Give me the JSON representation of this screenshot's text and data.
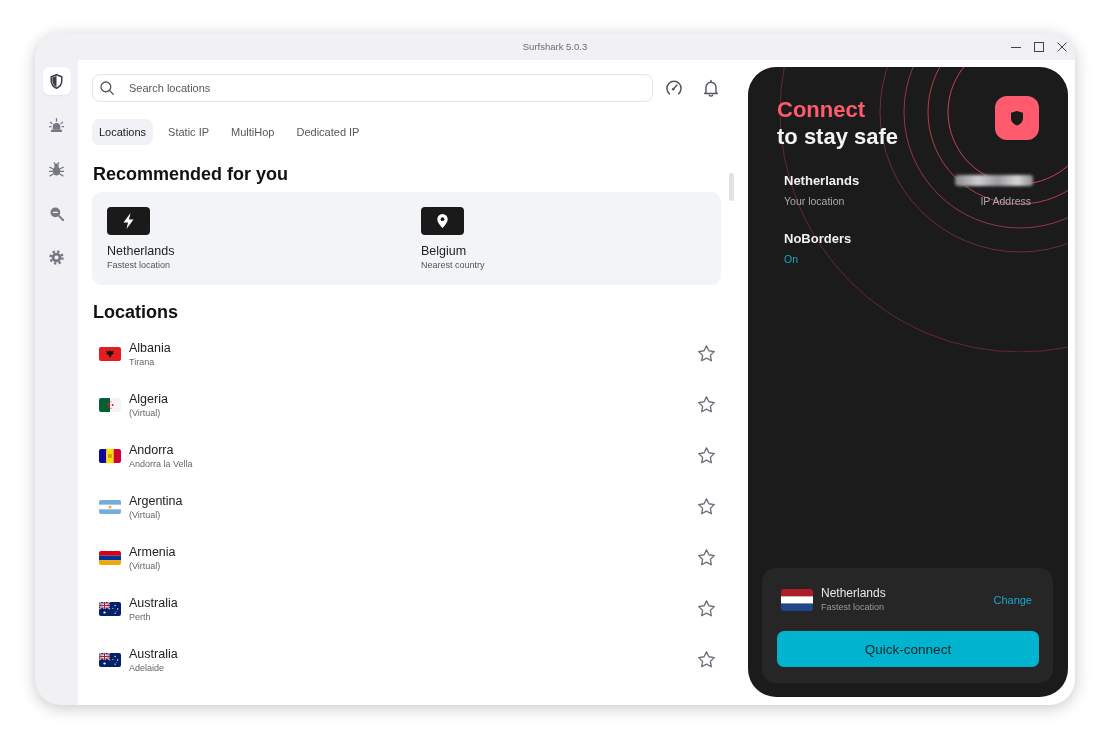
{
  "window": {
    "title": "Surfshark 5.0.3"
  },
  "sidebar": {
    "items": [
      {
        "kind": "shield",
        "selected": true
      },
      {
        "kind": "alert",
        "selected": false
      },
      {
        "kind": "bug",
        "selected": false
      },
      {
        "kind": "search",
        "selected": false
      },
      {
        "kind": "settings",
        "selected": false
      }
    ]
  },
  "search": {
    "placeholder": "Search locations"
  },
  "tabs": [
    {
      "label": "Locations",
      "selected": true
    },
    {
      "label": "Static IP",
      "selected": false
    },
    {
      "label": "MultiHop",
      "selected": false
    },
    {
      "label": "Dedicated IP",
      "selected": false
    }
  ],
  "recommended": {
    "title": "Recommended for you",
    "items": [
      {
        "kind": "fastest",
        "name": "Netherlands",
        "detail": "Fastest location"
      },
      {
        "kind": "nearest",
        "name": "Belgium",
        "detail": "Nearest country"
      }
    ]
  },
  "locations": {
    "title": "Locations",
    "rows": [
      {
        "flag": {
          "kind": "albania"
        },
        "name": "Albania",
        "detail": "Tirana",
        "favorite": false
      },
      {
        "flag": {
          "kind": "algeria"
        },
        "name": "Algeria",
        "detail": "(Virtual)",
        "favorite": false
      },
      {
        "flag": {
          "kind": "andorra"
        },
        "name": "Andorra",
        "detail": "Andorra la Vella",
        "favorite": false
      },
      {
        "flag": {
          "kind": "argentina"
        },
        "name": "Argentina",
        "detail": "(Virtual)",
        "favorite": false
      },
      {
        "flag": {
          "kind": "armenia"
        },
        "name": "Armenia",
        "detail": "(Virtual)",
        "favorite": false
      },
      {
        "flag": {
          "kind": "australia"
        },
        "name": "Australia",
        "detail": "Perth",
        "favorite": false
      },
      {
        "flag": {
          "kind": "australia"
        },
        "name": "Australia",
        "detail": "Adelaide",
        "favorite": false
      }
    ]
  },
  "connect_panel": {
    "headline": {
      "accent": "Connect",
      "rest": "to stay safe"
    },
    "location": {
      "name": "Netherlands",
      "label": "Your location"
    },
    "ip_address": {
      "label": "IP Address"
    },
    "noborders": {
      "name": "NoBorders",
      "status": "On"
    },
    "quick_connect": {
      "flag": {
        "kind": "netherlands"
      },
      "name": "Netherlands",
      "detail": "Fastest location",
      "link": "Change",
      "button": "Quick-connect"
    }
  }
}
